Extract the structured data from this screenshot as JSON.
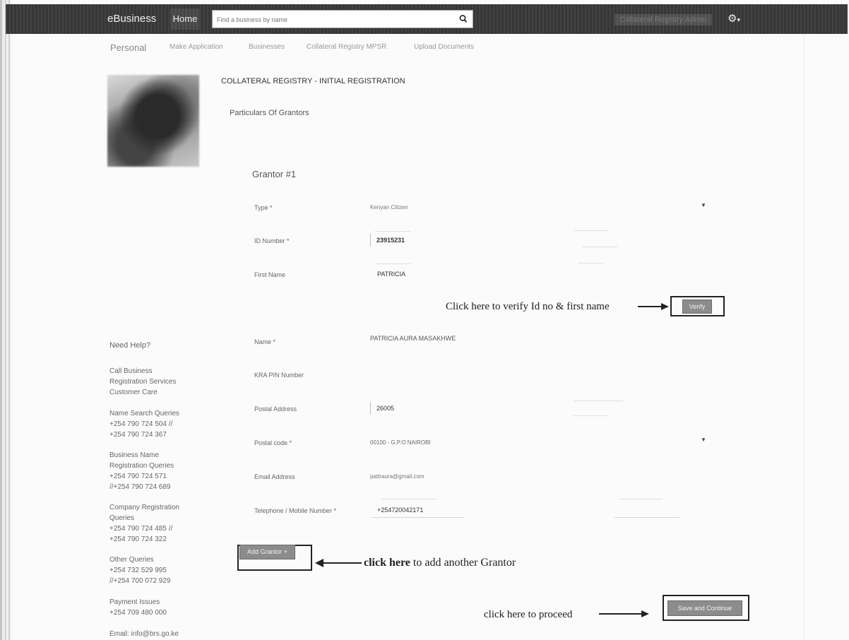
{
  "navbar": {
    "brand": "eBusiness",
    "home": "Home",
    "search_placeholder": "Find a business by name",
    "user_label": "Collateral Registry Admin"
  },
  "tabs": [
    {
      "label": "Personal"
    },
    {
      "label": "Make Application"
    },
    {
      "label": "Businesses"
    },
    {
      "label": "Collateral Registry MPSR"
    },
    {
      "label": "Upload Documents"
    }
  ],
  "page": {
    "title": "COLLATERAL REGISTRY - INITIAL REGISTRATION",
    "section": "Particulars Of Grantors",
    "grantor_heading": "Grantor #1"
  },
  "form": {
    "type": {
      "label": "Type *",
      "value": "Kenyan Citizen"
    },
    "id_number": {
      "label": "ID Number *",
      "value": "23915231"
    },
    "first_name": {
      "label": "First Name",
      "value": "PATRICIA"
    },
    "verify_button": "Verify",
    "name": {
      "label": "Name *",
      "value": "PATRICIA AURA MASAKHWE"
    },
    "kra_pin": {
      "label": "KRA PIN Number",
      "value": ""
    },
    "postal_address": {
      "label": "Postal Address",
      "value": "26005"
    },
    "postal_code": {
      "label": "Postal code *",
      "value": "00100 - G.P.O NAIROBI"
    },
    "email": {
      "label": "Email Address",
      "value": "pattraura@gmail.com"
    },
    "telephone": {
      "label": "Telephone / Mobile Number *",
      "value": "+254720042171"
    },
    "add_grantor_button": "Add Grantor +",
    "save_continue_button": "Save and Continue"
  },
  "annotations": {
    "verify_note": "Click here to verify Id no & first name",
    "add_note_bold": "click here",
    "add_note_rest": " to add another Grantor",
    "proceed_note": "click here to proceed"
  },
  "help": {
    "title": "Need Help?",
    "call_lines": [
      "Call Business",
      "Registration Services",
      "Customer Care"
    ],
    "name_search": {
      "label": "Name Search Queries",
      "phone1": "+254 790 724 504 //",
      "phone2": "+254 790 724 367"
    },
    "business_name": {
      "lines": [
        "Business Name",
        "Registration Queries"
      ],
      "phone1": "+254 790 724 571",
      "phone2": "//+254 790 724 689"
    },
    "company": {
      "lines": [
        "Company Registration",
        "Queries"
      ],
      "phone1": "+254 790 724 485 //",
      "phone2": "+254 790 724 322"
    },
    "other": {
      "label": "Other Queries",
      "phone1": "+254 732 529 995",
      "phone2": "//+254 700 072 929"
    },
    "payment": {
      "label": "Payment Issues",
      "phone1": "+254 709 480 000"
    },
    "email": "Email: info@brs.go.ke"
  }
}
